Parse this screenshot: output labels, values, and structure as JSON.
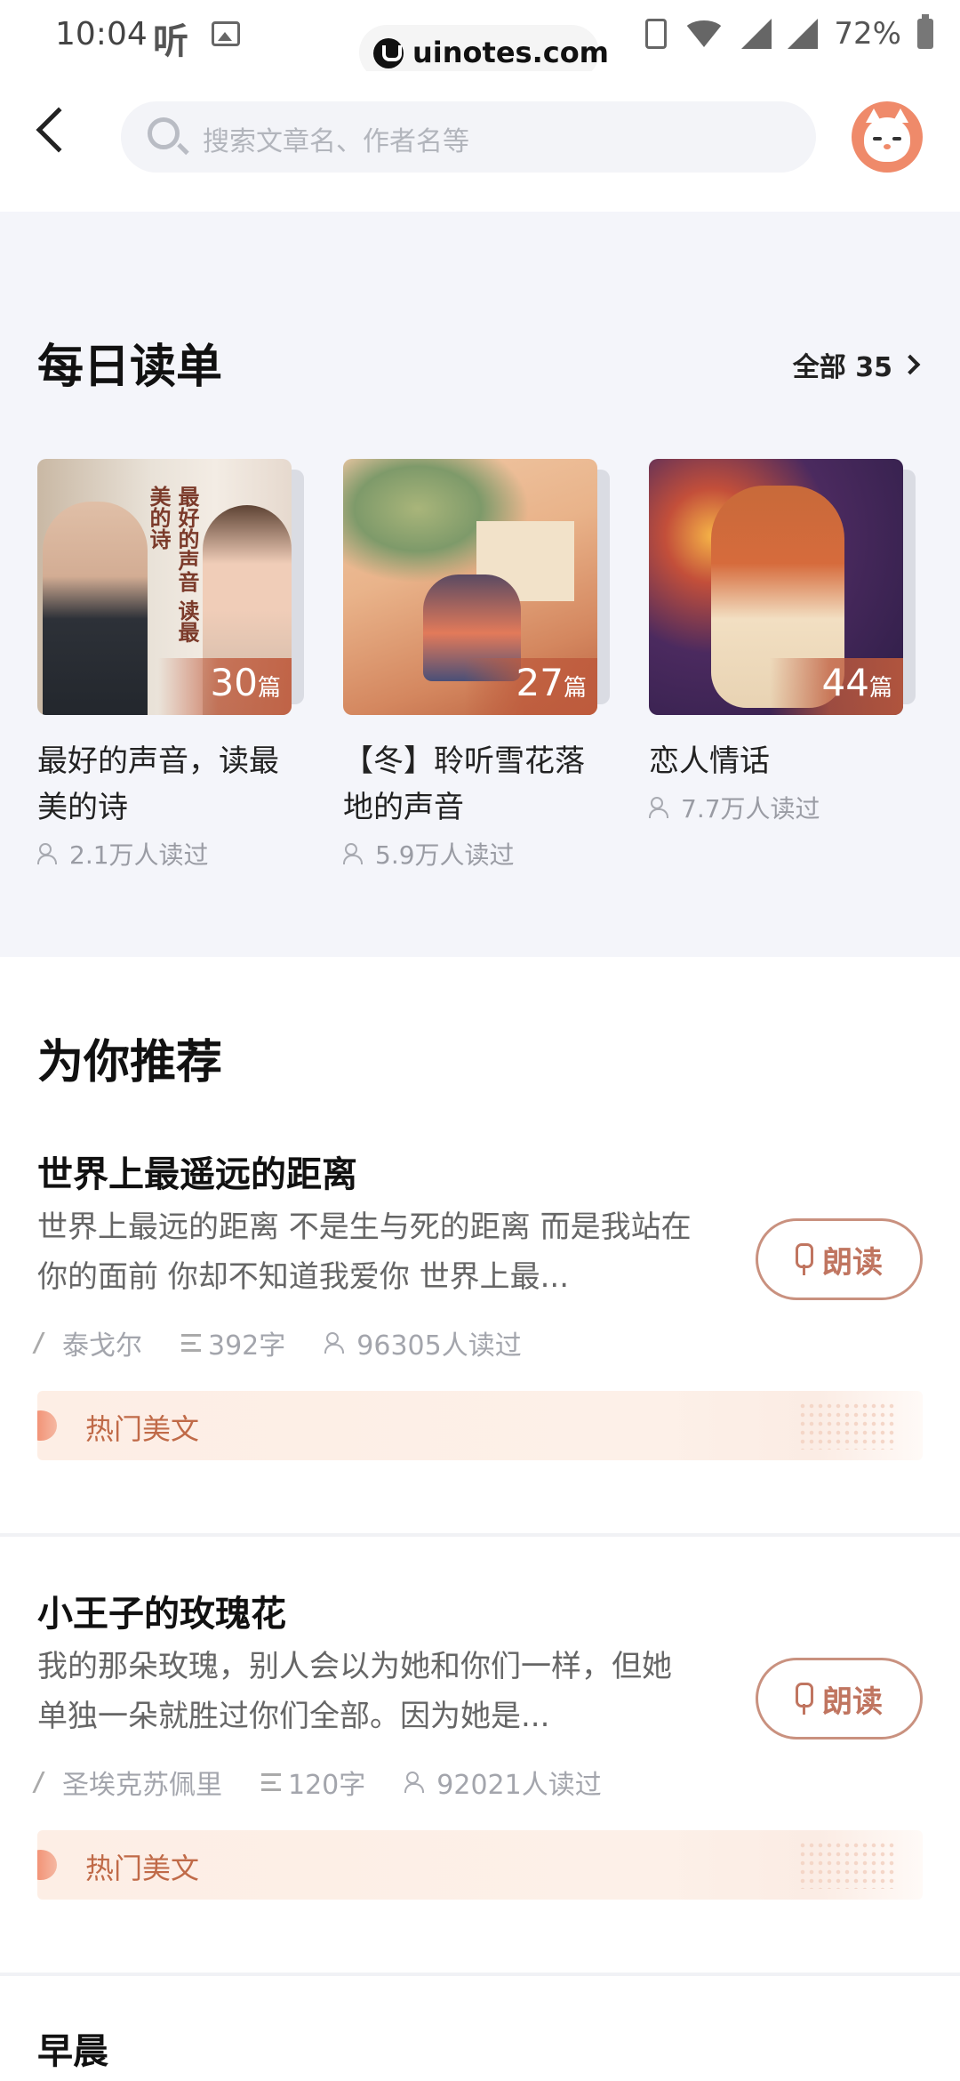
{
  "status_bar": {
    "time": "10:04",
    "app_glyph": "听",
    "watermark": "uinotes.com",
    "battery": "72%"
  },
  "header": {
    "search_placeholder": "搜索文章名、作者名等"
  },
  "daily": {
    "title": "每日读单",
    "all_label": "全部 35",
    "cards": [
      {
        "title": "最好的声音，读最美的诗",
        "count": "30",
        "unit": "篇",
        "readers": "2.1万人读过",
        "cover_text": "最好的声音 读最美的诗"
      },
      {
        "title": "【冬】聆听雪花落地的声音",
        "count": "27",
        "unit": "篇",
        "readers": "5.9万人读过"
      },
      {
        "title": "恋人情话",
        "count": "44",
        "unit": "篇",
        "readers": "7.7万人读过"
      }
    ]
  },
  "recommend": {
    "title": "为你推荐",
    "read_label": "朗读",
    "articles": [
      {
        "title": "世界上最遥远的距离",
        "desc": "世界上最远的距离 不是生与死的距离 而是我站在你的面前 你却不知道我爱你 世界上最...",
        "author": "泰戈尔",
        "length": "392字",
        "readers": "96305人读过",
        "tag": "热门美文"
      },
      {
        "title": "小王子的玫瑰花",
        "desc": "我的那朵玫瑰，别人会以为她和你们一样，但她单独一朵就胜过你们全部。因为她是...",
        "author": "圣埃克苏佩里",
        "length": "120字",
        "readers": "92021人读过",
        "tag": "热门美文"
      }
    ],
    "next_title": "早晨"
  },
  "colors": {
    "accent": "#c07560",
    "section_bg": "#f4f5fa",
    "tag_bg": "#fdeee5"
  }
}
